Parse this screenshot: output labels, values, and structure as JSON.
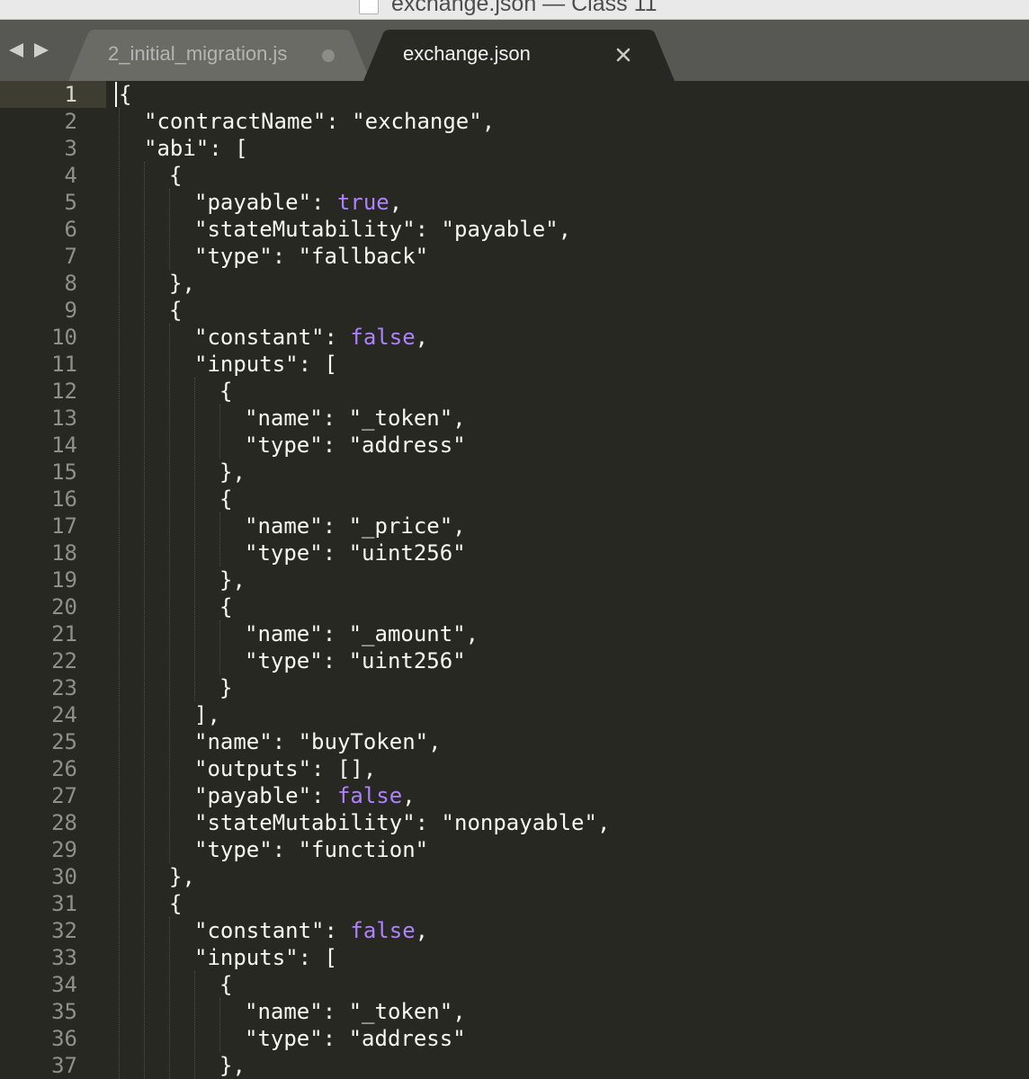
{
  "window": {
    "title": "exchange.json — Class 11"
  },
  "tabs": [
    {
      "label": "2_initial_migration.js",
      "dirty": true,
      "active": false
    },
    {
      "label": "exchange.json",
      "dirty": false,
      "active": true
    }
  ],
  "editor": {
    "active_line": 1,
    "line_numbers": [
      "1",
      "2",
      "3",
      "4",
      "5",
      "6",
      "7",
      "8",
      "9",
      "10",
      "11",
      "12",
      "13",
      "14",
      "15",
      "16",
      "17",
      "18",
      "19",
      "20",
      "21",
      "22",
      "23",
      "24",
      "25",
      "26",
      "27",
      "28",
      "29",
      "30",
      "31",
      "32",
      "33",
      "34",
      "35",
      "36",
      "37"
    ],
    "lines": [
      {
        "indent": 0,
        "tokens": [
          {
            "t": "p",
            "v": "{"
          }
        ]
      },
      {
        "indent": 1,
        "tokens": [
          {
            "t": "k",
            "v": "\"contractName\""
          },
          {
            "t": "p",
            "v": ": "
          },
          {
            "t": "s",
            "v": "\"exchange\""
          },
          {
            "t": "p",
            "v": ","
          }
        ]
      },
      {
        "indent": 1,
        "tokens": [
          {
            "t": "k",
            "v": "\"abi\""
          },
          {
            "t": "p",
            "v": ": ["
          }
        ]
      },
      {
        "indent": 2,
        "tokens": [
          {
            "t": "p",
            "v": "{"
          }
        ]
      },
      {
        "indent": 3,
        "tokens": [
          {
            "t": "k",
            "v": "\"payable\""
          },
          {
            "t": "p",
            "v": ": "
          },
          {
            "t": "b",
            "v": "true"
          },
          {
            "t": "p",
            "v": ","
          }
        ]
      },
      {
        "indent": 3,
        "tokens": [
          {
            "t": "k",
            "v": "\"stateMutability\""
          },
          {
            "t": "p",
            "v": ": "
          },
          {
            "t": "s",
            "v": "\"payable\""
          },
          {
            "t": "p",
            "v": ","
          }
        ]
      },
      {
        "indent": 3,
        "tokens": [
          {
            "t": "k",
            "v": "\"type\""
          },
          {
            "t": "p",
            "v": ": "
          },
          {
            "t": "s",
            "v": "\"fallback\""
          }
        ]
      },
      {
        "indent": 2,
        "tokens": [
          {
            "t": "p",
            "v": "},"
          }
        ]
      },
      {
        "indent": 2,
        "tokens": [
          {
            "t": "p",
            "v": "{"
          }
        ]
      },
      {
        "indent": 3,
        "tokens": [
          {
            "t": "k",
            "v": "\"constant\""
          },
          {
            "t": "p",
            "v": ": "
          },
          {
            "t": "b",
            "v": "false"
          },
          {
            "t": "p",
            "v": ","
          }
        ]
      },
      {
        "indent": 3,
        "tokens": [
          {
            "t": "k",
            "v": "\"inputs\""
          },
          {
            "t": "p",
            "v": ": ["
          }
        ]
      },
      {
        "indent": 4,
        "tokens": [
          {
            "t": "p",
            "v": "{"
          }
        ]
      },
      {
        "indent": 5,
        "tokens": [
          {
            "t": "k",
            "v": "\"name\""
          },
          {
            "t": "p",
            "v": ": "
          },
          {
            "t": "s",
            "v": "\"_token\""
          },
          {
            "t": "p",
            "v": ","
          }
        ]
      },
      {
        "indent": 5,
        "tokens": [
          {
            "t": "k",
            "v": "\"type\""
          },
          {
            "t": "p",
            "v": ": "
          },
          {
            "t": "s",
            "v": "\"address\""
          }
        ]
      },
      {
        "indent": 4,
        "tokens": [
          {
            "t": "p",
            "v": "},"
          }
        ]
      },
      {
        "indent": 4,
        "tokens": [
          {
            "t": "p",
            "v": "{"
          }
        ]
      },
      {
        "indent": 5,
        "tokens": [
          {
            "t": "k",
            "v": "\"name\""
          },
          {
            "t": "p",
            "v": ": "
          },
          {
            "t": "s",
            "v": "\"_price\""
          },
          {
            "t": "p",
            "v": ","
          }
        ]
      },
      {
        "indent": 5,
        "tokens": [
          {
            "t": "k",
            "v": "\"type\""
          },
          {
            "t": "p",
            "v": ": "
          },
          {
            "t": "s",
            "v": "\"uint256\""
          }
        ]
      },
      {
        "indent": 4,
        "tokens": [
          {
            "t": "p",
            "v": "},"
          }
        ]
      },
      {
        "indent": 4,
        "tokens": [
          {
            "t": "p",
            "v": "{"
          }
        ]
      },
      {
        "indent": 5,
        "tokens": [
          {
            "t": "k",
            "v": "\"name\""
          },
          {
            "t": "p",
            "v": ": "
          },
          {
            "t": "s",
            "v": "\"_amount\""
          },
          {
            "t": "p",
            "v": ","
          }
        ]
      },
      {
        "indent": 5,
        "tokens": [
          {
            "t": "k",
            "v": "\"type\""
          },
          {
            "t": "p",
            "v": ": "
          },
          {
            "t": "s",
            "v": "\"uint256\""
          }
        ]
      },
      {
        "indent": 4,
        "tokens": [
          {
            "t": "p",
            "v": "}"
          }
        ]
      },
      {
        "indent": 3,
        "tokens": [
          {
            "t": "p",
            "v": "],"
          }
        ]
      },
      {
        "indent": 3,
        "tokens": [
          {
            "t": "k",
            "v": "\"name\""
          },
          {
            "t": "p",
            "v": ": "
          },
          {
            "t": "s",
            "v": "\"buyToken\""
          },
          {
            "t": "p",
            "v": ","
          }
        ]
      },
      {
        "indent": 3,
        "tokens": [
          {
            "t": "k",
            "v": "\"outputs\""
          },
          {
            "t": "p",
            "v": ": [],"
          }
        ]
      },
      {
        "indent": 3,
        "tokens": [
          {
            "t": "k",
            "v": "\"payable\""
          },
          {
            "t": "p",
            "v": ": "
          },
          {
            "t": "b",
            "v": "false"
          },
          {
            "t": "p",
            "v": ","
          }
        ]
      },
      {
        "indent": 3,
        "tokens": [
          {
            "t": "k",
            "v": "\"stateMutability\""
          },
          {
            "t": "p",
            "v": ": "
          },
          {
            "t": "s",
            "v": "\"nonpayable\""
          },
          {
            "t": "p",
            "v": ","
          }
        ]
      },
      {
        "indent": 3,
        "tokens": [
          {
            "t": "k",
            "v": "\"type\""
          },
          {
            "t": "p",
            "v": ": "
          },
          {
            "t": "s",
            "v": "\"function\""
          }
        ]
      },
      {
        "indent": 2,
        "tokens": [
          {
            "t": "p",
            "v": "},"
          }
        ]
      },
      {
        "indent": 2,
        "tokens": [
          {
            "t": "p",
            "v": "{"
          }
        ]
      },
      {
        "indent": 3,
        "tokens": [
          {
            "t": "k",
            "v": "\"constant\""
          },
          {
            "t": "p",
            "v": ": "
          },
          {
            "t": "b",
            "v": "false"
          },
          {
            "t": "p",
            "v": ","
          }
        ]
      },
      {
        "indent": 3,
        "tokens": [
          {
            "t": "k",
            "v": "\"inputs\""
          },
          {
            "t": "p",
            "v": ": ["
          }
        ]
      },
      {
        "indent": 4,
        "tokens": [
          {
            "t": "p",
            "v": "{"
          }
        ]
      },
      {
        "indent": 5,
        "tokens": [
          {
            "t": "k",
            "v": "\"name\""
          },
          {
            "t": "p",
            "v": ": "
          },
          {
            "t": "s",
            "v": "\"_token\""
          },
          {
            "t": "p",
            "v": ","
          }
        ]
      },
      {
        "indent": 5,
        "tokens": [
          {
            "t": "k",
            "v": "\"type\""
          },
          {
            "t": "p",
            "v": ": "
          },
          {
            "t": "s",
            "v": "\"address\""
          }
        ]
      },
      {
        "indent": 4,
        "tokens": [
          {
            "t": "p",
            "v": "},"
          }
        ]
      }
    ]
  },
  "colors": {
    "editor_background": "#272822",
    "text": "#f8f8f2",
    "boolean": "#ae81ff",
    "line_number": "#90908a",
    "tab_bar": "#575853"
  },
  "icons": {
    "nav_back": "triangle-left-icon",
    "nav_forward": "triangle-right-icon",
    "tab_close": "close-icon",
    "tab_dirty": "dirty-dot-icon",
    "document": "document-icon"
  }
}
